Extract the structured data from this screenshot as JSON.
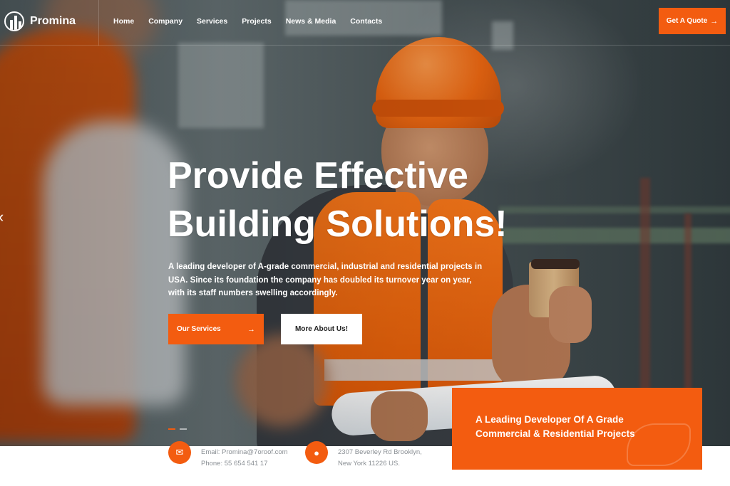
{
  "brand": {
    "name": "Promina"
  },
  "nav": {
    "items": [
      "Home",
      "Company",
      "Services",
      "Projects",
      "News & Media",
      "Contacts"
    ],
    "cta_label": "Get A Quote",
    "cta_icon": "arrow-right-icon"
  },
  "hero": {
    "title_line1": "Provide Effective",
    "title_line2": "Building Solutions!",
    "description": "A leading developer of A-grade commercial, industrial and residential projects in USA. Since its foundation the company has doubled its turnover year on year, with its staff numbers swelling accordingly.",
    "primary_button": "Our Services",
    "secondary_button": "More About Us!",
    "slide_count": 2,
    "active_slide": 1
  },
  "contact": {
    "email_line1": "Email: Promina@7oroof.com",
    "email_line2": "Phone: 55 654 541 17",
    "address_line1": "2307 Beverley Rd Brooklyn,",
    "address_line2": "New York 11226 US."
  },
  "promo": {
    "line1": "A Leading Developer Of A Grade",
    "line2": "Commercial & Residential Projects"
  },
  "colors": {
    "accent": "#f35c10",
    "text_light": "#ffffff",
    "muted": "#8a8f94"
  }
}
